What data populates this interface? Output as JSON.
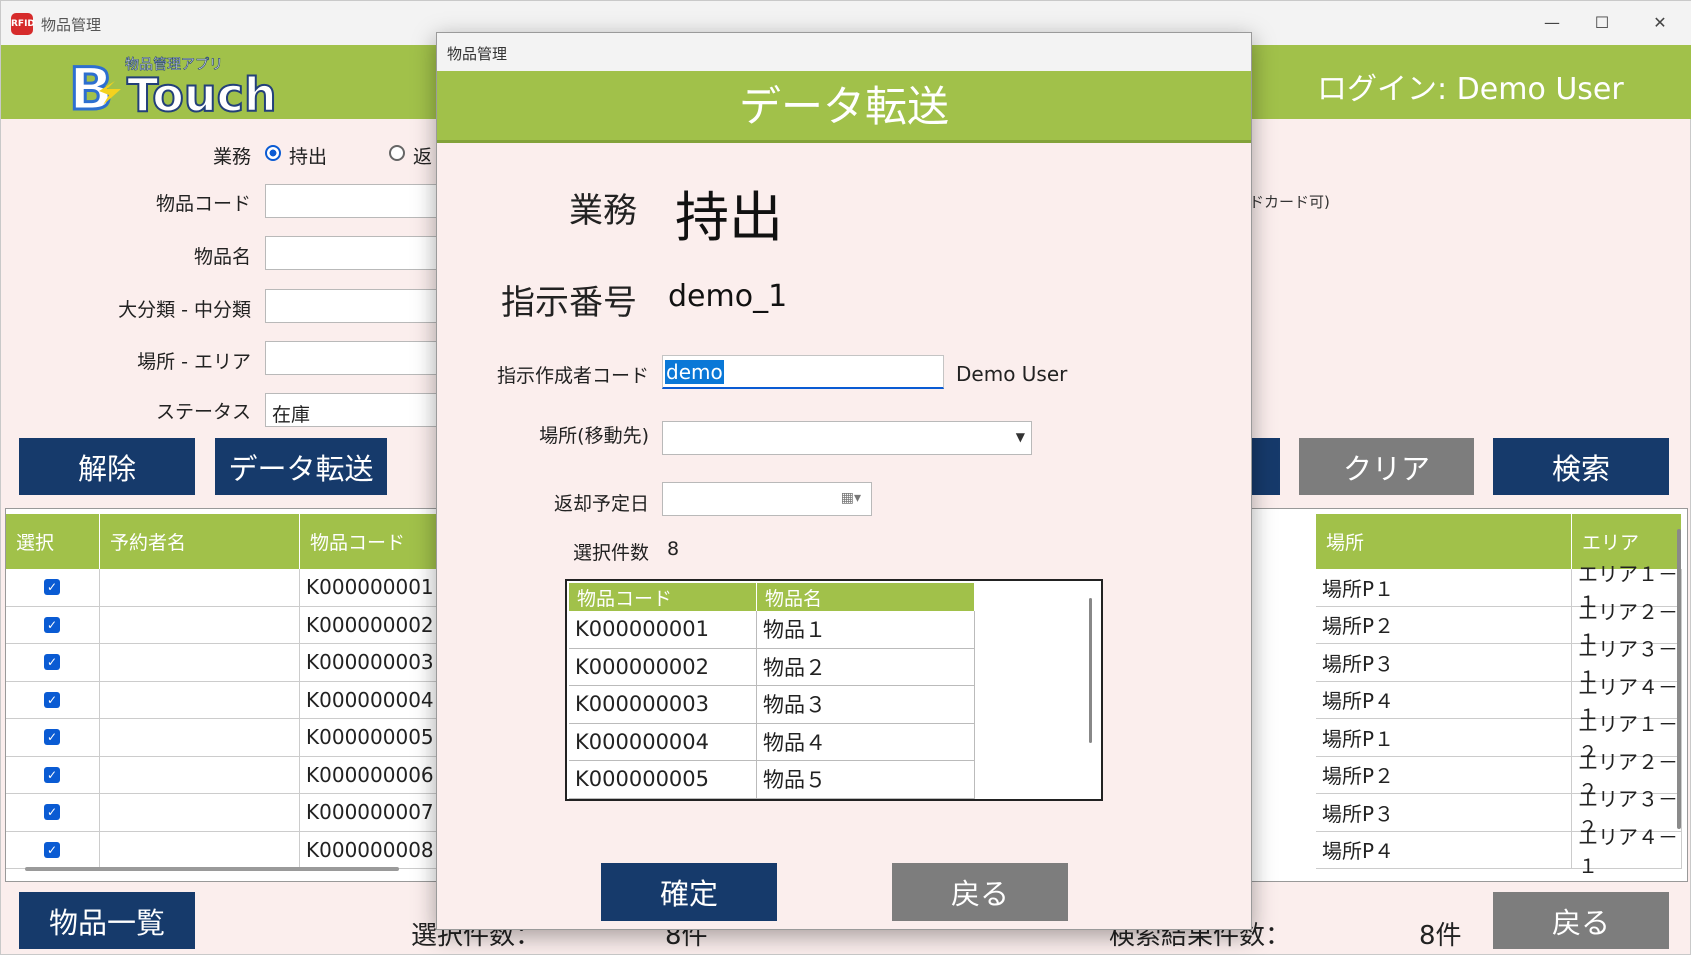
{
  "window": {
    "title": "物品管理",
    "app_icon": "rfid-app-icon"
  },
  "header": {
    "logo_sub": "物品管理アプリ",
    "logo_b": "B",
    "logo_main": "Touch",
    "login_label": "ログイン:",
    "login_user": "Demo User"
  },
  "form": {
    "gyomu_label": "業務",
    "radio1": "持出",
    "radio2": "返",
    "code_label": "物品コード",
    "name_label": "物品名",
    "category_label": "大分類 - 中分類",
    "place_label": "場所 - エリア",
    "status_label": "ステータス",
    "status_value": "在庫",
    "hint_text": "ドカード可)"
  },
  "buttons": {
    "release": "解除",
    "transfer": "データ転送",
    "clear": "クリア",
    "search": "検索",
    "list": "物品一覧",
    "back": "戻る"
  },
  "grid": {
    "headers": [
      "選択",
      "予約者名",
      "物品コード",
      "場所",
      "エリア"
    ],
    "rows": [
      {
        "code": "K000000001",
        "place": "場所P１",
        "area": "エリア１－１"
      },
      {
        "code": "K000000002",
        "place": "場所P２",
        "area": "エリア２－１"
      },
      {
        "code": "K000000003",
        "place": "場所P３",
        "area": "エリア３－１"
      },
      {
        "code": "K000000004",
        "place": "場所P４",
        "area": "エリア４－１"
      },
      {
        "code": "K000000005",
        "place": "場所P１",
        "area": "エリア１－２"
      },
      {
        "code": "K000000006",
        "place": "場所P２",
        "area": "エリア２－２"
      },
      {
        "code": "K000000007",
        "place": "場所P３",
        "area": "エリア３－２"
      },
      {
        "code": "K000000008",
        "place": "場所P４",
        "area": "エリア４－１"
      }
    ]
  },
  "footer": {
    "selected_label": "選択件数：",
    "selected_value": "8件",
    "result_label": "検索結果件数：",
    "result_value": "8件"
  },
  "dialog": {
    "window_title": "物品管理",
    "header": "データ転送",
    "gyomu_label": "業務",
    "gyomu_value": "持出",
    "order_label": "指示番号",
    "order_value": "demo_1",
    "creator_label": "指示作成者コード",
    "creator_value": "demo",
    "creator_name": "Demo User",
    "dest_label": "場所(移動先)",
    "dest_value": "",
    "return_label": "返却予定日",
    "return_value": "",
    "count_label": "選択件数",
    "count_value": "8",
    "table_headers": [
      "物品コード",
      "物品名"
    ],
    "table_rows": [
      {
        "code": "K000000001",
        "name": "物品１"
      },
      {
        "code": "K000000002",
        "name": "物品２"
      },
      {
        "code": "K000000003",
        "name": "物品３"
      },
      {
        "code": "K000000004",
        "name": "物品４"
      },
      {
        "code": "K000000005",
        "name": "物品５"
      }
    ],
    "confirm": "確定",
    "back": "戻る"
  }
}
